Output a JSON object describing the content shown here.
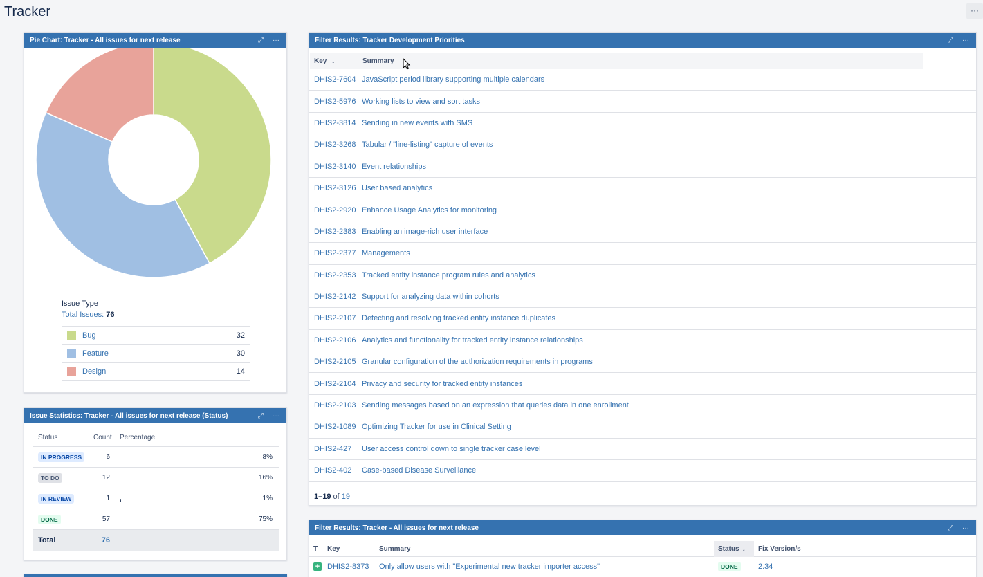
{
  "page": {
    "title": "Tracker",
    "more_label": "···"
  },
  "pie_gadget": {
    "title": "Pie Chart: Tracker - All issues for next release",
    "expand_icon": "⤢",
    "more_label": "···",
    "legend_title": "Issue Type",
    "total_label": "Total Issues:",
    "total_value": "76",
    "legend": [
      {
        "label": "Bug",
        "count": "32",
        "color": "#c9da8c"
      },
      {
        "label": "Feature",
        "count": "30",
        "color": "#a0bfe3"
      },
      {
        "label": "Design",
        "count": "14",
        "color": "#e8a39a"
      }
    ]
  },
  "chart_data": {
    "type": "pie",
    "categories": [
      "Bug",
      "Feature",
      "Design"
    ],
    "values": [
      32,
      30,
      14
    ],
    "colors": [
      "#c9da8c",
      "#a0bfe3",
      "#e8a39a"
    ],
    "donut": true
  },
  "stats_gadget": {
    "title": "Issue Statistics: Tracker - All issues for next release (Status)",
    "expand_icon": "⤢",
    "more_label": "···",
    "headers": {
      "status": "Status",
      "count": "Count",
      "percentage": "Percentage"
    },
    "rows": [
      {
        "status": "IN PROGRESS",
        "count": "6",
        "pct": "8%",
        "fraction": 0.08,
        "lozenge": "blue"
      },
      {
        "status": "TO DO",
        "count": "12",
        "pct": "16%",
        "fraction": 0.16,
        "lozenge": "grey"
      },
      {
        "status": "IN REVIEW",
        "count": "1",
        "pct": "1%",
        "fraction": 0.01,
        "lozenge": "blue"
      },
      {
        "status": "DONE",
        "count": "57",
        "pct": "75%",
        "fraction": 0.75,
        "lozenge": "green"
      }
    ],
    "total_label": "Total",
    "total_value": "76"
  },
  "filter1": {
    "title": "Filter Results: Tracker Development Priorities",
    "expand_icon": "⤢",
    "more_label": "···",
    "headers": {
      "key": "Key",
      "summary": "Summary",
      "sort_icon": "↓"
    },
    "rows": [
      {
        "key": "DHIS2-7604",
        "summary": "JavaScript period library supporting multiple calendars"
      },
      {
        "key": "DHIS2-5976",
        "summary": "Working lists to view and sort tasks"
      },
      {
        "key": "DHIS2-3814",
        "summary": "Sending in new events with SMS"
      },
      {
        "key": "DHIS2-3268",
        "summary": "Tabular / \"line-listing\" capture of events"
      },
      {
        "key": "DHIS2-3140",
        "summary": "Event relationships"
      },
      {
        "key": "DHIS2-3126",
        "summary": "User based analytics"
      },
      {
        "key": "DHIS2-2920",
        "summary": "Enhance Usage Analytics for monitoring"
      },
      {
        "key": "DHIS2-2383",
        "summary": "Enabling an image-rich user interface"
      },
      {
        "key": "DHIS2-2377",
        "summary": "Managements"
      },
      {
        "key": "DHIS2-2353",
        "summary": "Tracked entity instance program rules and analytics"
      },
      {
        "key": "DHIS2-2142",
        "summary": "Support for analyzing data within cohorts"
      },
      {
        "key": "DHIS2-2107",
        "summary": "Detecting and resolving tracked entity instance duplicates"
      },
      {
        "key": "DHIS2-2106",
        "summary": "Analytics and functionality for tracked entity instance relationships"
      },
      {
        "key": "DHIS2-2105",
        "summary": "Granular configuration of the authorization requirements in programs"
      },
      {
        "key": "DHIS2-2104",
        "summary": "Privacy and security for tracked entity instances"
      },
      {
        "key": "DHIS2-2103",
        "summary": "Sending messages based on an expression that queries data in one enrollment"
      },
      {
        "key": "DHIS2-1089",
        "summary": "Optimizing Tracker for use in Clinical Setting"
      },
      {
        "key": "DHIS2-427",
        "summary": "User access control down to single tracker case level"
      },
      {
        "key": "DHIS2-402",
        "summary": "Case-based Disease Surveillance"
      }
    ],
    "pager": {
      "range": "1–19",
      "of_label": "of",
      "total": "19"
    }
  },
  "filter2": {
    "title": "Filter Results: Tracker - All issues for next release",
    "expand_icon": "⤢",
    "more_label": "···",
    "headers": {
      "t": "T",
      "key": "Key",
      "summary": "Summary",
      "status": "Status",
      "sort_icon": "↓",
      "fix": "Fix Version/s"
    },
    "rows": [
      {
        "type_icon": "+",
        "key": "DHIS2-8373",
        "summary": "Only allow users with \"Experimental new tracker importer access\"",
        "status": "DONE",
        "fix": "2.34"
      }
    ]
  }
}
